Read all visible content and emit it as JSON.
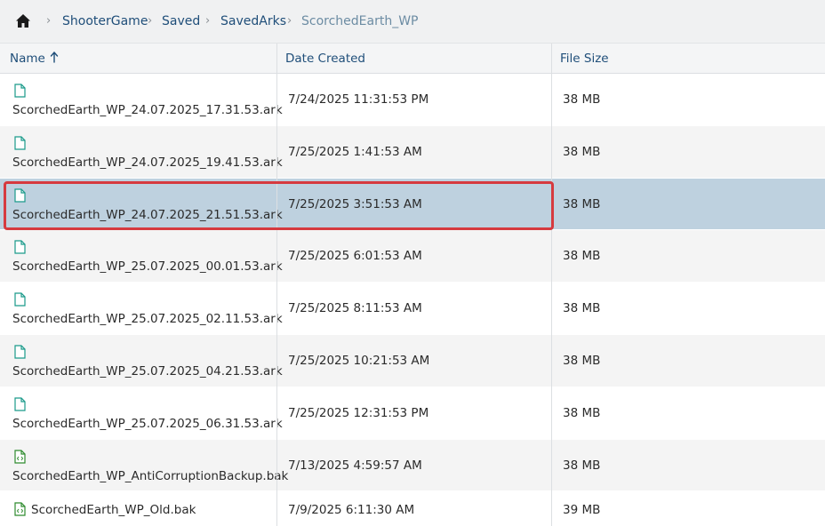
{
  "breadcrumb": {
    "home_icon": "home-icon",
    "items": [
      "ShooterGame",
      "Saved",
      "SavedArks"
    ],
    "current": "ScorchedEarth_WP"
  },
  "columns": {
    "name": "Name",
    "date": "Date Created",
    "size": "File Size",
    "sort_icon": "sort-ascending-icon"
  },
  "files": [
    {
      "name": "ScorchedEarth_WP_24.07.2025_17.31.53.ark",
      "date": "7/24/2025 11:31:53 PM",
      "size": "38 MB",
      "icon": "file-icon"
    },
    {
      "name": "ScorchedEarth_WP_24.07.2025_19.41.53.ark",
      "date": "7/25/2025 1:41:53 AM",
      "size": "38 MB",
      "icon": "file-icon"
    },
    {
      "name": "ScorchedEarth_WP_24.07.2025_21.51.53.ark",
      "date": "7/25/2025 3:51:53 AM",
      "size": "38 MB",
      "icon": "file-icon",
      "selected": true
    },
    {
      "name": "ScorchedEarth_WP_25.07.2025_00.01.53.ark",
      "date": "7/25/2025 6:01:53 AM",
      "size": "38 MB",
      "icon": "file-icon"
    },
    {
      "name": "ScorchedEarth_WP_25.07.2025_02.11.53.ark",
      "date": "7/25/2025 8:11:53 AM",
      "size": "38 MB",
      "icon": "file-icon"
    },
    {
      "name": "ScorchedEarth_WP_25.07.2025_04.21.53.ark",
      "date": "7/25/2025 10:21:53 AM",
      "size": "38 MB",
      "icon": "file-icon"
    },
    {
      "name": "ScorchedEarth_WP_25.07.2025_06.31.53.ark",
      "date": "7/25/2025 12:31:53 PM",
      "size": "38 MB",
      "icon": "file-icon"
    },
    {
      "name": "ScorchedEarth_WP_AntiCorruptionBackup.bak",
      "date": "7/13/2025 4:59:57 AM",
      "size": "38 MB",
      "icon": "code-file-icon"
    },
    {
      "name": "ScorchedEarth_WP_Old.bak",
      "date": "7/9/2025 6:11:30 AM",
      "size": "39 MB",
      "icon": "code-file-icon"
    }
  ],
  "colors": {
    "accent": "#1f4e79",
    "selected_row": "#bed1df",
    "highlight_border": "#d63a3f",
    "file_icon": "#1a9a8a",
    "code_file_icon": "#2e8b2e"
  }
}
